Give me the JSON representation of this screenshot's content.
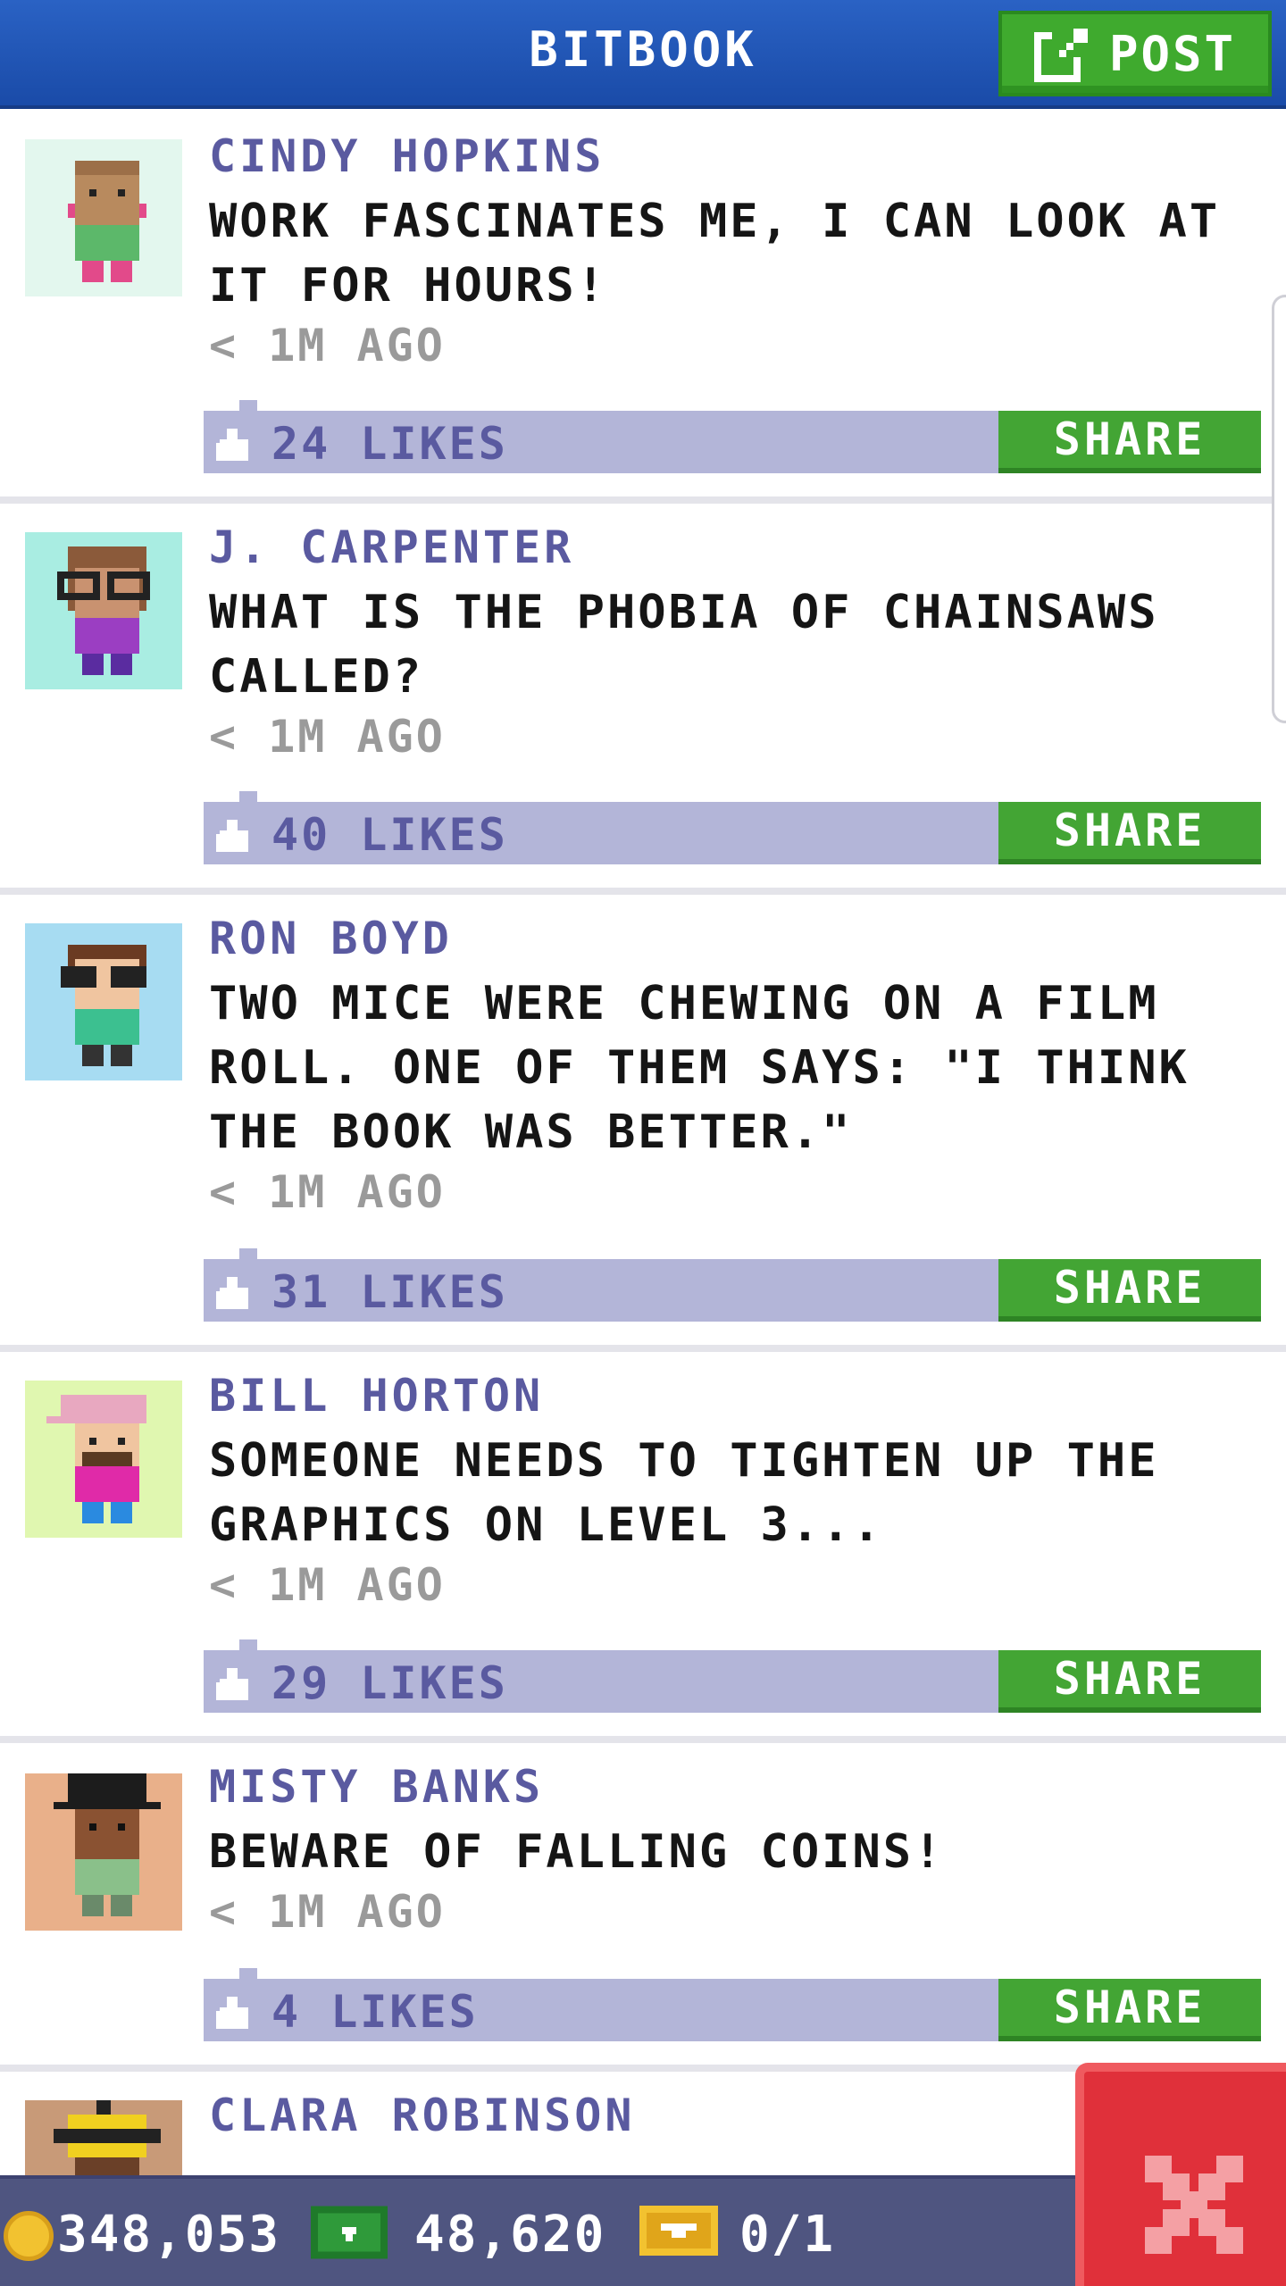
{
  "header": {
    "title": "BITBOOK",
    "post_label": "POST"
  },
  "posts": [
    {
      "author": "CINDY HOPKINS",
      "message": "WORK FASCINATES ME, I CAN LOOK AT IT FOR HOURS!",
      "time": "< 1M AGO",
      "likes": "24 LIKES",
      "share_label": "SHARE"
    },
    {
      "author": "J. CARPENTER",
      "message": "WHAT IS THE PHOBIA OF CHAINSAWS CALLED?",
      "time": "< 1M AGO",
      "likes": "40 LIKES",
      "share_label": "SHARE"
    },
    {
      "author": "RON BOYD",
      "message": "TWO MICE WERE CHEWING ON A FILM ROLL. ONE OF THEM SAYS: \"I THINK THE BOOK WAS BETTER.\"",
      "time": "< 1M AGO",
      "likes": "31 LIKES",
      "share_label": "SHARE"
    },
    {
      "author": "BILL HORTON",
      "message": "SOMEONE NEEDS TO TIGHTEN UP THE GRAPHICS ON LEVEL 3...",
      "time": "< 1M AGO",
      "likes": "29 LIKES",
      "share_label": "SHARE"
    },
    {
      "author": "MISTY BANKS",
      "message": "BEWARE OF FALLING COINS!",
      "time": "< 1M AGO",
      "likes": "4 LIKES",
      "share_label": "SHARE"
    },
    {
      "author": "CLARA ROBINSON"
    }
  ],
  "status": {
    "coins": "348,053",
    "bux": "48,620",
    "tickets": "0/1"
  },
  "colors": {
    "header_blue": "#1a4ba8",
    "share_green": "#43a534",
    "like_bar": "#b3b5d8",
    "author_purple": "#5a5aa0",
    "close_red": "#e0303a"
  },
  "icons": [
    "post-edit-icon",
    "like-icon",
    "coin-icon",
    "cash-icon",
    "ticket-icon",
    "close-icon"
  ]
}
